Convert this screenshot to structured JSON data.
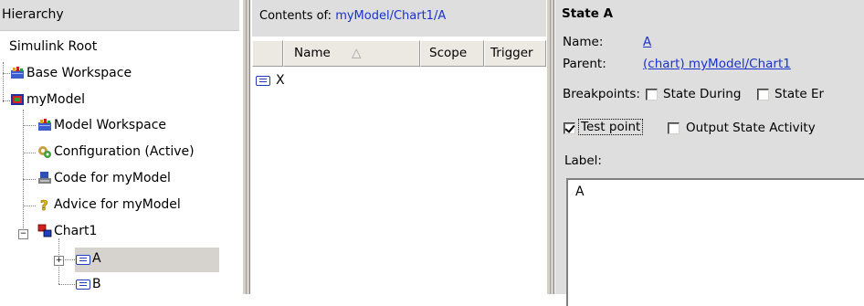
{
  "hierarchy": {
    "header": "Hierarchy",
    "root": "Simulink Root",
    "items": [
      {
        "label": "Base Workspace",
        "icon": "workspace-icon"
      },
      {
        "label": "myModel",
        "icon": "model-icon"
      },
      {
        "label": "Model Workspace",
        "icon": "workspace-icon"
      },
      {
        "label": "Configuration (Active)",
        "icon": "configuration-icon"
      },
      {
        "label": "Code for myModel",
        "icon": "code-icon"
      },
      {
        "label": "Advice for myModel",
        "icon": "advice-icon"
      },
      {
        "label": "Chart1",
        "icon": "chart-icon"
      },
      {
        "label": "A",
        "icon": "state-icon",
        "selected": true
      },
      {
        "label": "B",
        "icon": "state-icon"
      }
    ]
  },
  "contents": {
    "prefix": "Contents of: ",
    "path": "myModel/Chart1/A",
    "columns": [
      "Name",
      "Scope",
      "Trigger"
    ],
    "sort_indicator": "△",
    "rows": [
      {
        "name": "X"
      }
    ]
  },
  "state": {
    "title": "State A",
    "name_label": "Name:",
    "name_value": "A",
    "parent_label": "Parent:",
    "parent_value": "(chart) myModel/Chart1",
    "breakpoints_label": "Breakpoints:",
    "state_during_label": "State During",
    "state_entry_label": "State Er",
    "test_point_label": "Test point",
    "test_point_checked": true,
    "output_state_label": "Output State Activity",
    "label_label": "Label:",
    "label_text": "A"
  }
}
